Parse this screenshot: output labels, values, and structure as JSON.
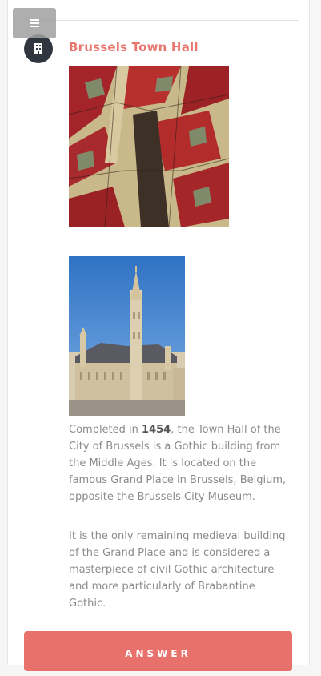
{
  "article": {
    "title": "Brussels Town Hall",
    "paragraph1": {
      "before": "Completed in ",
      "bold": "1454",
      "after": ", the Town Hall of the City of Brussels is a Gothic building from the Middle Ages. It is located on the famous Grand Place in Brussels, Belgium, opposite the Brussels City Museum."
    },
    "paragraph2": "It is the only remaining medieval building of the Grand Place and is considered a masterpiece of civil Gothic architecture and more particularly of Brabantine Gothic."
  },
  "answer_button": {
    "label": "ANSWER"
  },
  "icons": {
    "menu": "hamburger-menu-icon",
    "badge": "building-icon"
  },
  "colors": {
    "accent": "#e8776f",
    "badge": "#2f3640",
    "button": "#e8716b"
  }
}
